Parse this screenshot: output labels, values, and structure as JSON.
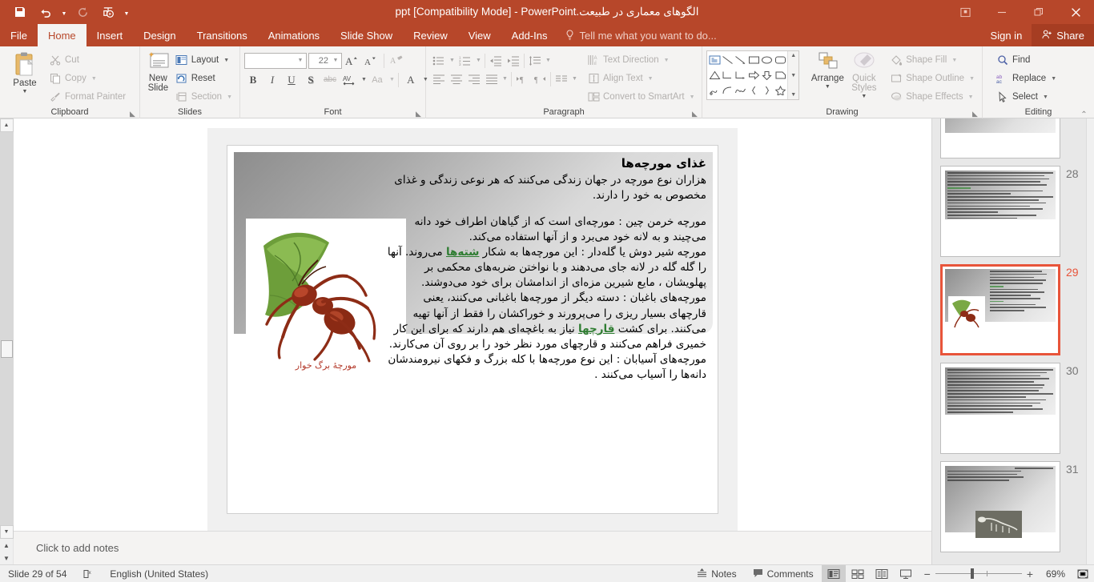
{
  "titlebar": {
    "document_title": "الگوهای معماری در طبیعت.ppt [Compatibility Mode] - PowerPoint",
    "qat": {
      "save": "save-icon",
      "undo": "undo-icon",
      "redo": "redo-icon",
      "present": "start-presentation-icon",
      "customize": "customize-qat-icon"
    },
    "window": {
      "ribbon_display": "ribbon-display-options",
      "minimize": "minimize",
      "restore": "restore",
      "close": "close"
    }
  },
  "tabs": [
    {
      "label": "File",
      "active": false
    },
    {
      "label": "Home",
      "active": true
    },
    {
      "label": "Insert",
      "active": false
    },
    {
      "label": "Design",
      "active": false
    },
    {
      "label": "Transitions",
      "active": false
    },
    {
      "label": "Animations",
      "active": false
    },
    {
      "label": "Slide Show",
      "active": false
    },
    {
      "label": "Review",
      "active": false
    },
    {
      "label": "View",
      "active": false
    },
    {
      "label": "Add-Ins",
      "active": false
    }
  ],
  "tellme": {
    "placeholder": "Tell me what you want to do..."
  },
  "account": {
    "signin": "Sign in",
    "share": "Share"
  },
  "ribbon": {
    "clipboard": {
      "title": "Clipboard",
      "paste": "Paste",
      "cut": "Cut",
      "copy": "Copy",
      "format_painter": "Format Painter"
    },
    "slides": {
      "title": "Slides",
      "new_slide": "New Slide",
      "layout": "Layout",
      "reset": "Reset",
      "section": "Section"
    },
    "font": {
      "title": "Font",
      "font_name": "",
      "font_name_placeholder": "",
      "font_size": "22",
      "grow": "A",
      "shrink": "A",
      "clear_formatting": "clear-formatting-icon",
      "bold": "B",
      "italic": "I",
      "underline": "U",
      "shadow": "S",
      "strikethrough": "abc",
      "character_spacing": "AV",
      "change_case": "Aa",
      "font_color": "A"
    },
    "paragraph": {
      "title": "Paragraph",
      "text_direction": "Text Direction",
      "align_text": "Align Text",
      "convert_smartart": "Convert to SmartArt"
    },
    "drawing": {
      "title": "Drawing",
      "arrange": "Arrange",
      "quick_styles": "Quick Styles",
      "shape_fill": "Shape Fill",
      "shape_outline": "Shape Outline",
      "shape_effects": "Shape Effects"
    },
    "editing": {
      "title": "Editing",
      "find": "Find",
      "replace": "Replace",
      "select": "Select"
    }
  },
  "slide": {
    "title": "غذای مورچه‌ها",
    "paragraphs": [
      "هزاران نوع مورچه در جهان زندگی می‌کنند که هر نوعی زندگی و غذای مخصوص به خود را دارند.",
      "مورچه خرمن چین : مورچه‌ای است که از گیاهان اطراف خود دانه می‌چیند و به لانه خود می‌برد و از آنها استفاده می‌کند.",
      "مورچه شیر دوش یا گله‌دار : این مورچه‌ها به شکار شته‌ها می‌روند. آنها را گله گله در لانه جای می‌دهند و با نواختن ضربه‌های محکمی بر پهلویشان ، مایع شیرین مزه‌ای از اندامشان برای خود می‌دوشند.",
      "مورچه‌های باغبان : دسته دیگر از مورچه‌ها باغبانی می‌کنند، یعنی قارچهای بسیار ریزی را می‌پرورند و خوراکشان را فقط از آنها تهیه می‌کنند. برای کشت قارچها نیاز به باغچه‌ای هم دارند که برای این کار خمیری فراهم می‌کنند و قارچهای مورد نظر خود را بر روی آن می‌کارند.",
      "مورچه‌های آسیابان : این نوع مورچه‌ها با کله بزرگ و فکهای نیرومندشان دانه‌ها را آسیاب می‌کنند ."
    ],
    "links": [
      "شته‌ها",
      "قارچها"
    ],
    "image_caption": "مورچهٔ برگ خوار",
    "image_alt": "leafcutter-ant-photo"
  },
  "notes": {
    "placeholder": "Click to add notes"
  },
  "thumbnails": [
    {
      "number": "",
      "selected": false,
      "kind": "orange-text"
    },
    {
      "number": "28",
      "selected": false,
      "kind": "text"
    },
    {
      "number": "29",
      "selected": true,
      "kind": "ant"
    },
    {
      "number": "30",
      "selected": false,
      "kind": "text"
    },
    {
      "number": "31",
      "selected": false,
      "kind": "skeleton"
    }
  ],
  "status": {
    "slide_counter": "Slide 29 of 54",
    "spellcheck_icon": "spellcheck-icon",
    "language": "English (United States)",
    "notes_button": "Notes",
    "comments_button": "Comments",
    "views": [
      "normal-view",
      "slide-sorter-view",
      "reading-view",
      "slide-show-view"
    ],
    "zoom_out": "−",
    "zoom_in": "+",
    "zoom_level": "69%",
    "fit_to_window": "fit-slide-to-window-icon"
  },
  "colors": {
    "accent": "#b7472a",
    "ribbon_bg": "#f4f3f2",
    "selection": "#e8543a",
    "link_green": "#2f7d32",
    "caption_red": "#b3392a"
  }
}
